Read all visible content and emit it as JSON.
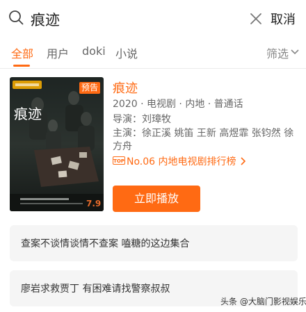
{
  "search": {
    "query": "痕迹",
    "cancel_label": "取消"
  },
  "tabs": [
    {
      "label": "全部",
      "active": true
    },
    {
      "label": "用户",
      "active": false
    },
    {
      "label": "doki",
      "active": false
    },
    {
      "label": "小说",
      "active": false
    }
  ],
  "filter_label": "筛选",
  "result": {
    "title": "痕迹",
    "badge": "预告",
    "meta": "2020 · 电视剧 · 内地 · 普通话",
    "director": "导演：刘璋牧",
    "cast": "主演：徐正溪 姚笛 王新 高煜霏 张钧然 徐方舟",
    "rank": "No.06 内地电视剧排行榜",
    "play_label": "立即播放",
    "poster": {
      "title_text": "痕迹",
      "date_text": "7.9"
    }
  },
  "suggestions": [
    {
      "text": "查案不谈情谈情不查案  嗑糖的这边集合"
    },
    {
      "text": "廖岩求救贾丁  有困难请找警察叔叔"
    }
  ],
  "watermark": "头条 @大脑门影视娱乐",
  "colors": {
    "accent": "#ff6a13",
    "suggest_bg": "#f5f5f5"
  }
}
